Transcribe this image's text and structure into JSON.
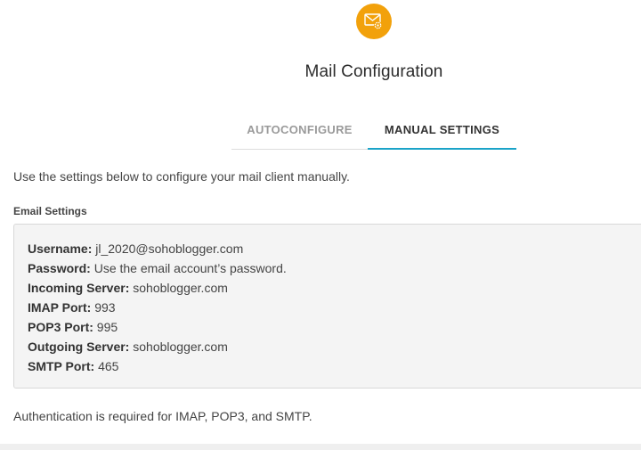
{
  "header": {
    "icon": "mail-settings-icon",
    "icon_color": "#f2a10b",
    "title": "Mail Configuration"
  },
  "tabs": [
    {
      "label": "AUTOCONFIGURE",
      "active": false
    },
    {
      "label": "MANUAL SETTINGS",
      "active": true
    }
  ],
  "accent_color": "#1aa3c8",
  "intro": "Use the settings below to configure your mail client manually.",
  "email_settings": {
    "label": "Email Settings",
    "rows": [
      {
        "label": "Username:",
        "value": "jl_2020@sohoblogger.com"
      },
      {
        "label": "Password:",
        "value": "Use the email account’s password."
      },
      {
        "label": "Incoming Server:",
        "value": "sohoblogger.com"
      },
      {
        "label": "IMAP Port:",
        "value": "993"
      },
      {
        "label": "POP3 Port:",
        "value": "995"
      },
      {
        "label": "Outgoing Server:",
        "value": "sohoblogger.com"
      },
      {
        "label": "SMTP Port:",
        "value": "465"
      }
    ]
  },
  "footer_note": "Authentication is required for IMAP, POP3, and SMTP."
}
